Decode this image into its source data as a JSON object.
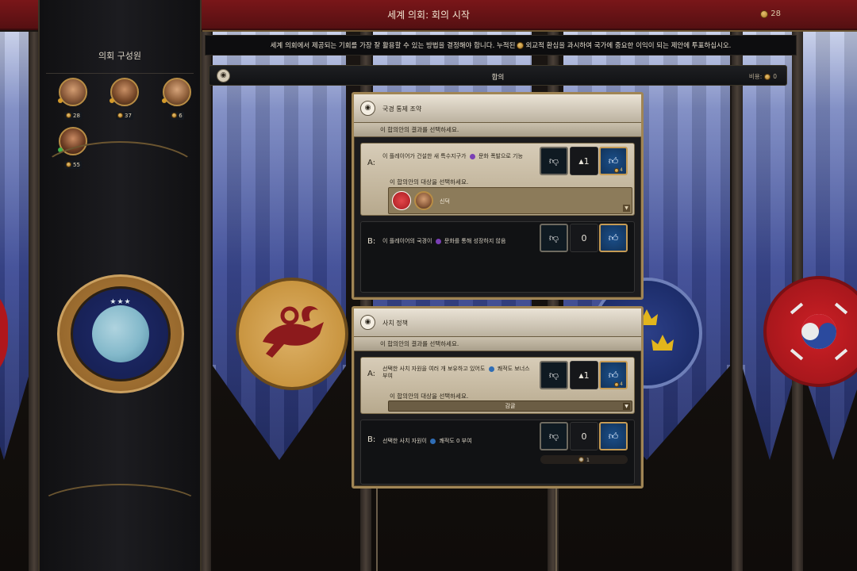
{
  "header": {
    "title": "세계 의회: 회의 시작",
    "coins": "28"
  },
  "sidebar": {
    "title": "의회 구성원",
    "members": [
      {
        "count": "28"
      },
      {
        "count": "37"
      },
      {
        "count": "6"
      },
      {
        "count": "55"
      }
    ],
    "emblem_stars": "★★★"
  },
  "instruction": {
    "part1": "세계 의회에서 제공되는 기회를 가장 잘 활용할 수 있는 방법을 결정해야 합니다. 누적된",
    "part2": "외교적 환심을 과시하여 국가에 중요한 이익이 되는 제안에 투표하십시오."
  },
  "agreement": {
    "title": "합의",
    "cost_label": "비용:",
    "cost_value": "0"
  },
  "resolutions": [
    {
      "title": "국경 통제 조약",
      "subtitle": "이 합의안의 결과를 선택하세요.",
      "option_a": {
        "letter": "A:",
        "text_pre": "이 플레이어가 건설한 새 특수지구가",
        "text_post": "문화 폭발으로 기능",
        "target_label": "이 합의안의 대상을 선택하세요.",
        "target_name": "신덕",
        "votes": "1",
        "up_cost": "4"
      },
      "option_b": {
        "letter": "B:",
        "text_pre": "이 플레이어의 국경이",
        "text_post": "문화를 통해 성장하지 않음",
        "votes": "0"
      }
    },
    {
      "title": "사치 정책",
      "subtitle": "이 합의안의 결과를 선택하세요.",
      "option_a": {
        "letter": "A:",
        "text_pre": "선택한 사치 자원을 여러 개 보유하고 있어도",
        "text_post": "쾌적도 보너스 부여",
        "target_label": "이 합의안의 대상을 선택하세요.",
        "target_name": "감귤",
        "votes": "1",
        "up_cost": "4"
      },
      "option_b": {
        "letter": "B:",
        "text_pre": "선택한 사치 자원이",
        "text_post": "쾌적도 0 부여",
        "votes": "0",
        "pill_value": "1"
      }
    }
  ],
  "colors": {
    "top_bar": "#7a1619",
    "card_border": "#a08555",
    "vote_up": "#1b4f8a"
  },
  "icons": [
    "coin-icon",
    "thumbs-down-icon",
    "thumbs-up-icon",
    "culture-icon",
    "amenity-icon",
    "dropdown-arrow-icon"
  ]
}
